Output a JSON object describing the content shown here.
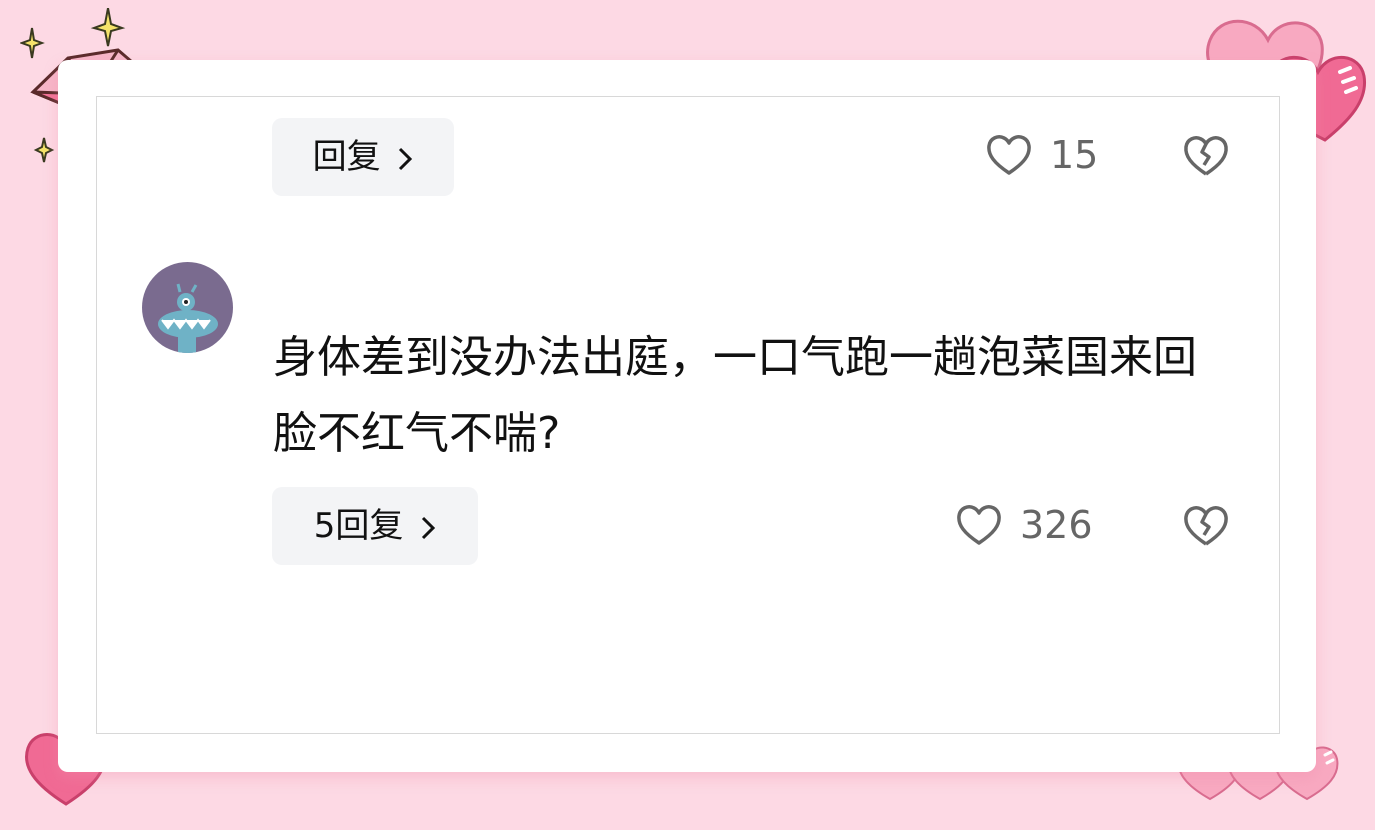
{
  "comments": [
    {
      "reply_label": "回复",
      "like_count": "15"
    },
    {
      "avatar_icon": "fish-monster-icon",
      "text": "身体差到没办法出庭，一口气跑一趟泡菜国来回脸不红气不喘?",
      "reply_label": "5回复",
      "like_count": "326"
    }
  ],
  "icons": {
    "like": "heart-outline-icon",
    "dislike": "broken-heart-icon",
    "chevron": "chevron-right-icon"
  },
  "colors": {
    "background": "#fdd9e4",
    "heart_pink": "#f06a94",
    "text": "#111111",
    "count_gray": "#666666"
  }
}
